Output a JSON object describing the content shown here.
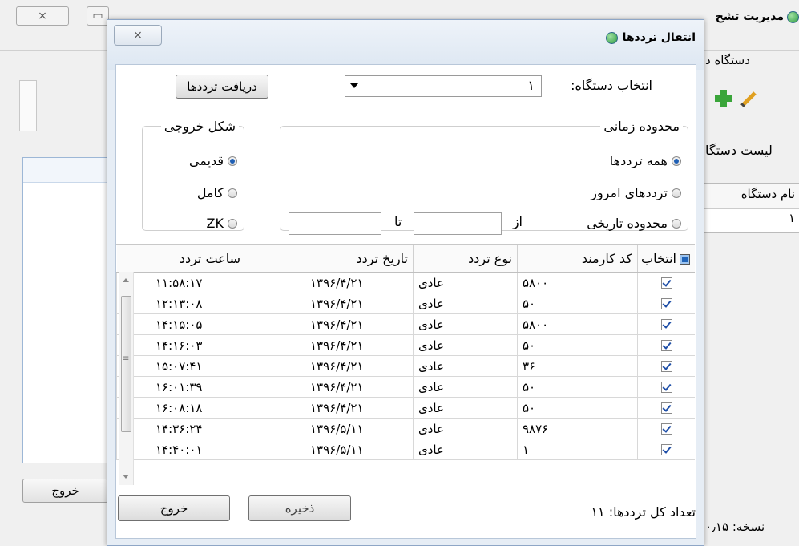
{
  "background_window": {
    "title": "مدیریت تشخ",
    "menu": "دستگاه د",
    "list_label": "لیست دستگا",
    "table_header": "نام دستگاه",
    "table_row": "۱",
    "exit_button": "خروج",
    "version": "نسخه: ۰٫۱۵",
    "close_glyph": "⨯",
    "restore_glyph": "▭"
  },
  "dialog": {
    "title": "انتقال ترددها",
    "close_glyph": "⨯",
    "fetch_button": "دریافت ترددها",
    "device_label": "انتخاب دستگاه:",
    "device_value": "۱",
    "output_group": {
      "legend": "شکل خروجی",
      "options": [
        "قدیمی",
        "کامل",
        "ZK"
      ],
      "selected": 0
    },
    "range_group": {
      "legend": "محدوده زمانی",
      "options": [
        "همه ترددها",
        "ترددهای امروز",
        "محدوده تاریخی"
      ],
      "selected": 0,
      "from_label": "از",
      "to_label": "تا",
      "from_value": "",
      "to_value": ""
    },
    "grid": {
      "columns": [
        "انتخاب",
        "کد کارمند",
        "نوع تردد",
        "تاریخ تردد",
        "ساعت تردد"
      ],
      "rows": [
        {
          "checked": true,
          "code": "۵۸۰۰",
          "type": "عادی",
          "date": "۱۳۹۶/۴/۲۱",
          "time": "۱۱:۵۸:۱۷"
        },
        {
          "checked": true,
          "code": "۵۰",
          "type": "عادی",
          "date": "۱۳۹۶/۴/۲۱",
          "time": "۱۲:۱۳:۰۸"
        },
        {
          "checked": true,
          "code": "۵۸۰۰",
          "type": "عادی",
          "date": "۱۳۹۶/۴/۲۱",
          "time": "۱۴:۱۵:۰۵"
        },
        {
          "checked": true,
          "code": "۵۰",
          "type": "عادی",
          "date": "۱۳۹۶/۴/۲۱",
          "time": "۱۴:۱۶:۰۳"
        },
        {
          "checked": true,
          "code": "۳۶",
          "type": "عادی",
          "date": "۱۳۹۶/۴/۲۱",
          "time": "۱۵:۰۷:۴۱"
        },
        {
          "checked": true,
          "code": "۵۰",
          "type": "عادی",
          "date": "۱۳۹۶/۴/۲۱",
          "time": "۱۶:۰۱:۳۹"
        },
        {
          "checked": true,
          "code": "۵۰",
          "type": "عادی",
          "date": "۱۳۹۶/۴/۲۱",
          "time": "۱۶:۰۸:۱۸"
        },
        {
          "checked": true,
          "code": "۹۸۷۶",
          "type": "عادی",
          "date": "۱۳۹۶/۵/۱۱",
          "time": "۱۴:۳۶:۲۴"
        },
        {
          "checked": true,
          "code": "۱",
          "type": "عادی",
          "date": "۱۳۹۶/۵/۱۱",
          "time": "۱۴:۴۰:۰۱"
        }
      ]
    },
    "total_label": "تعداد کل ترددها: ۱۱",
    "save_button": "ذخیره",
    "exit_button": "خروج"
  },
  "colors": {
    "accent": "#1f5fb4",
    "dialog_bg": "#e6edf5",
    "border": "#8ea6c6"
  }
}
